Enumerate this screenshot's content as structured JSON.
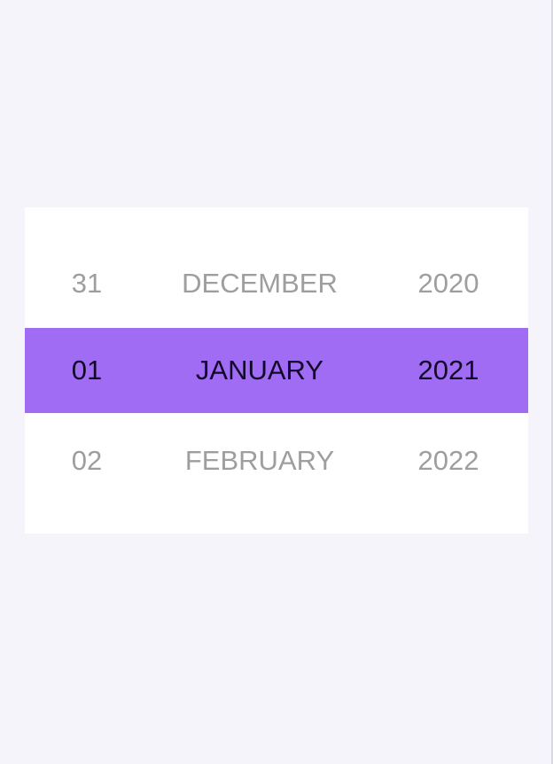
{
  "picker": {
    "rows": [
      {
        "day": "31",
        "month": "DECEMBER",
        "year": "2020"
      },
      {
        "day": "01",
        "month": "JANUARY",
        "year": "2021"
      },
      {
        "day": "02",
        "month": "FEBRUARY",
        "year": "2022"
      }
    ],
    "selected": {
      "day": "01",
      "month": "JANUARY",
      "year": "2021"
    }
  },
  "colors": {
    "background": "#f5f4fb",
    "panel": "#ffffff",
    "selection": "#a06cf4",
    "unselected_text": "#9e9e9e",
    "selected_text": "#12082a"
  }
}
